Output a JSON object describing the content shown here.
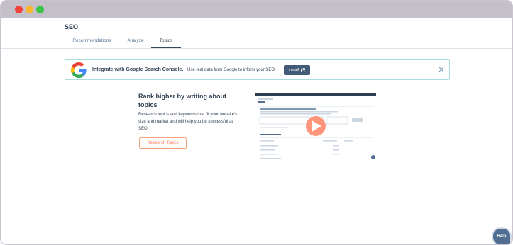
{
  "header": {
    "title": "SEO"
  },
  "tabs": [
    {
      "label": "Recommendations",
      "active": false
    },
    {
      "label": "Analyze",
      "active": false
    },
    {
      "label": "Topics",
      "active": true
    }
  ],
  "banner": {
    "title": "Integrate with Google Search Console.",
    "text": "Use real data from Google to inform your SEO.",
    "install_label": "Install",
    "logo_icon": "google-g-icon",
    "install_icon": "external-link-icon",
    "close_icon": "close-icon"
  },
  "promo": {
    "heading": "Rank higher by writing about topics",
    "description": "Research topics and keywords that fit your website's size and market and will help you be successful at SEO.",
    "button_label": "Research Topics"
  },
  "video": {
    "play_icon": "play-icon"
  },
  "help": {
    "label": "Help"
  },
  "colors": {
    "accent_orange": "#ff7a59",
    "button_dark": "#425b76",
    "banner_border": "#a8dfdc",
    "titlebar": "#c4bfc8"
  }
}
